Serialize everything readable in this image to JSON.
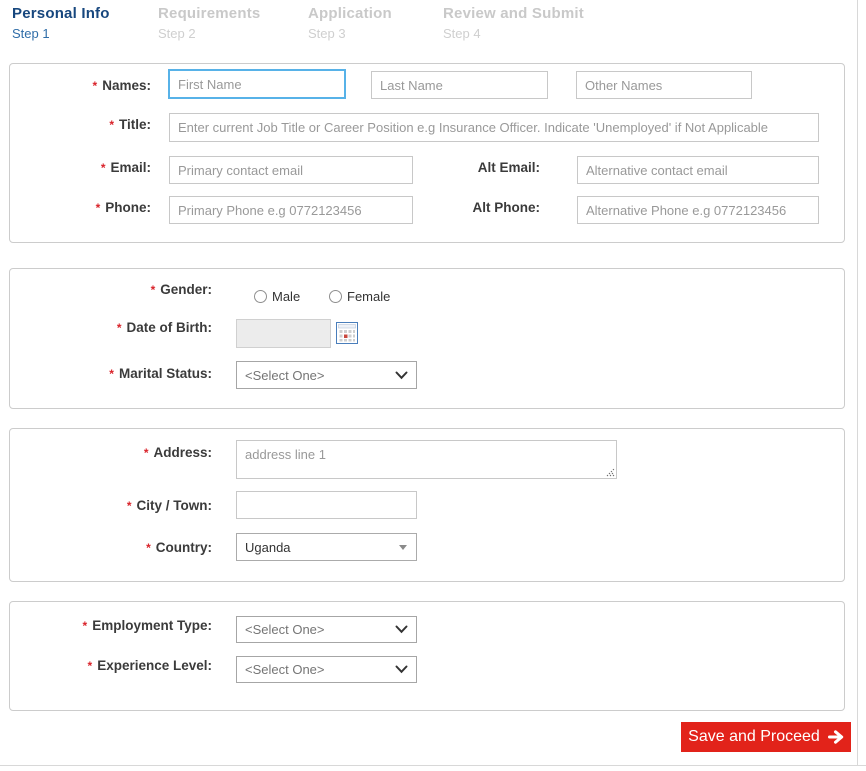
{
  "required_marker": "*",
  "steps": [
    {
      "title": "Personal Info",
      "substep": "Step 1"
    },
    {
      "title": "Requirements",
      "substep": "Step 2"
    },
    {
      "title": "Application",
      "substep": "Step 3"
    },
    {
      "title": "Review and Submit",
      "substep": "Step 4"
    }
  ],
  "identity": {
    "names_label": "Names:",
    "first_name_placeholder": "First Name",
    "last_name_placeholder": "Last Name",
    "other_names_placeholder": "Other Names",
    "title_label": "Title:",
    "title_placeholder": "Enter current Job Title or Career Position e.g Insurance Officer. Indicate 'Unemployed' if Not Applicable",
    "email_label": "Email:",
    "email_placeholder": "Primary contact email",
    "alt_email_label": "Alt Email:",
    "alt_email_placeholder": "Alternative contact email",
    "phone_label": "Phone:",
    "phone_placeholder": "Primary Phone e.g 0772123456",
    "alt_phone_label": "Alt Phone:",
    "alt_phone_placeholder": "Alternative Phone e.g 0772123456"
  },
  "demographics": {
    "gender_label": "Gender:",
    "male_label": "Male",
    "female_label": "Female",
    "dob_label": "Date of Birth:",
    "dob_value": "",
    "marital_label": "Marital Status:",
    "marital_value": "<Select One>"
  },
  "location": {
    "address_label": "Address:",
    "address_placeholder": "address line 1",
    "city_label": "City / Town:",
    "city_value": "",
    "country_label": "Country:",
    "country_value": "Uganda"
  },
  "employment": {
    "employment_type_label": "Employment Type:",
    "employment_type_value": "<Select One>",
    "experience_level_label": "Experience Level:",
    "experience_level_value": "<Select One>"
  },
  "actions": {
    "save_label": "Save and Proceed"
  },
  "colors": {
    "active_step_blue": "#17477e",
    "inactive_step_gray": "#c9c9c9",
    "focus_border_blue": "#57b2e8",
    "required_red": "#d9232a",
    "button_red": "#e2231a"
  }
}
